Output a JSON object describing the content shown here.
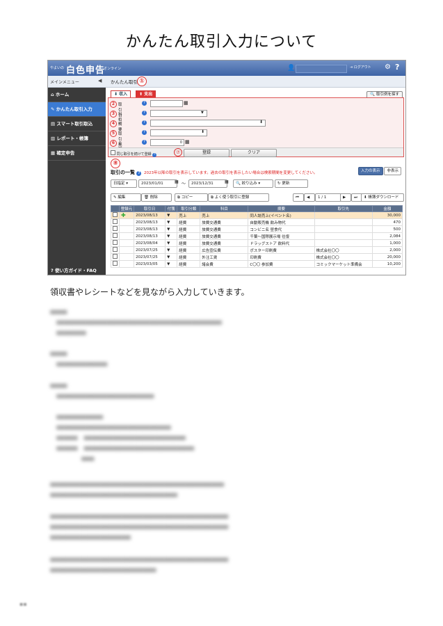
{
  "doc": {
    "title": "かんたん取引入力について",
    "description": "領収書やレシートなどを見ながら入力していきます。"
  },
  "app": {
    "brand_small": "やよいの",
    "brand_big": "白色申告",
    "brand_online": "オンライン",
    "logout": "ログアウト",
    "main_menu": "メインメニュー",
    "breadcrumb": "かんたん取引"
  },
  "sidebar": {
    "items": [
      {
        "label": "ホーム",
        "icon": "home-icon"
      },
      {
        "label": "かんたん取引入力",
        "icon": "pencil-icon"
      },
      {
        "label": "スマート取引取込",
        "icon": "import-icon"
      },
      {
        "label": "レポート・帳簿",
        "icon": "chart-icon"
      },
      {
        "label": "確定申告",
        "icon": "document-icon"
      }
    ],
    "help": "使い方ガイド・FAQ"
  },
  "form": {
    "tab_income": "収入",
    "tab_expense": "支出",
    "example_button": "取引例を探す",
    "fields": [
      {
        "num": "2",
        "label": "取引日 *",
        "value": ""
      },
      {
        "num": "3",
        "label": "科目 *",
        "value": ""
      },
      {
        "num": "4",
        "label": "摘要",
        "value": ""
      },
      {
        "num": "5",
        "label": "取引先",
        "value": ""
      },
      {
        "num": "6",
        "label": "金額 *",
        "value": "0"
      }
    ],
    "repeat_label": "同じ取引を続けて登録",
    "register": "登録",
    "clear": "クリア",
    "circle1": "①",
    "circle7": "⑦",
    "circle8": "⑧"
  },
  "list": {
    "title": "取引の一覧",
    "notice": "2023年以降の取引を表示しています。過去の取引を表示したい場合は検索期間を変更してください。",
    "view_input": "入力の表示",
    "view_hide": "非表示",
    "date_mode": "日指定",
    "date_from": "2023/01/01",
    "tilde": "〜",
    "date_to": "2023/12/31",
    "filter": "絞り込み",
    "refresh": "更新",
    "edit": "編集",
    "delete": "削除",
    "copy": "コピー",
    "favorite": "よく使う取引に登録",
    "page_current": "1",
    "page_sep": "/",
    "page_total": "1",
    "download": "帳簿ダウンロード",
    "headers": [
      "",
      "登録元",
      "取引日",
      "付箋",
      "取引分類",
      "科目",
      "摘要",
      "取引先",
      "金額"
    ],
    "rows": [
      {
        "date": "2023/08/13",
        "cls": "売上",
        "acct": "売上",
        "memo": "同人誌売上(イベント名)",
        "partner": "",
        "amount": "30,000"
      },
      {
        "date": "2023/08/13",
        "cls": "経費",
        "acct": "旅費交通費",
        "memo": "自動販売機 飲み物代",
        "partner": "",
        "amount": "470"
      },
      {
        "date": "2023/08/13",
        "cls": "経費",
        "acct": "旅費交通費",
        "memo": "コンビニ名 昼食代",
        "partner": "",
        "amount": "500"
      },
      {
        "date": "2023/08/13",
        "cls": "経費",
        "acct": "旅費交通費",
        "memo": "千葉〜国際展示場 往復",
        "partner": "",
        "amount": "2,084"
      },
      {
        "date": "2023/08/04",
        "cls": "経費",
        "acct": "旅費交通費",
        "memo": "ドラッグストア 飲料代",
        "partner": "",
        "amount": "1,000"
      },
      {
        "date": "2023/07/25",
        "cls": "経費",
        "acct": "広告宣伝費",
        "memo": "ポスター印刷費",
        "partner": "株式会社〇〇",
        "amount": "2,000"
      },
      {
        "date": "2023/07/25",
        "cls": "経費",
        "acct": "外注工賃",
        "memo": "印刷費",
        "partner": "株式会社〇〇",
        "amount": "20,000"
      },
      {
        "date": "2023/03/05",
        "cls": "経費",
        "acct": "諸会費",
        "memo": "C〇〇 参加費",
        "partner": "コミックマーケット準備会",
        "amount": "10,200"
      }
    ]
  }
}
